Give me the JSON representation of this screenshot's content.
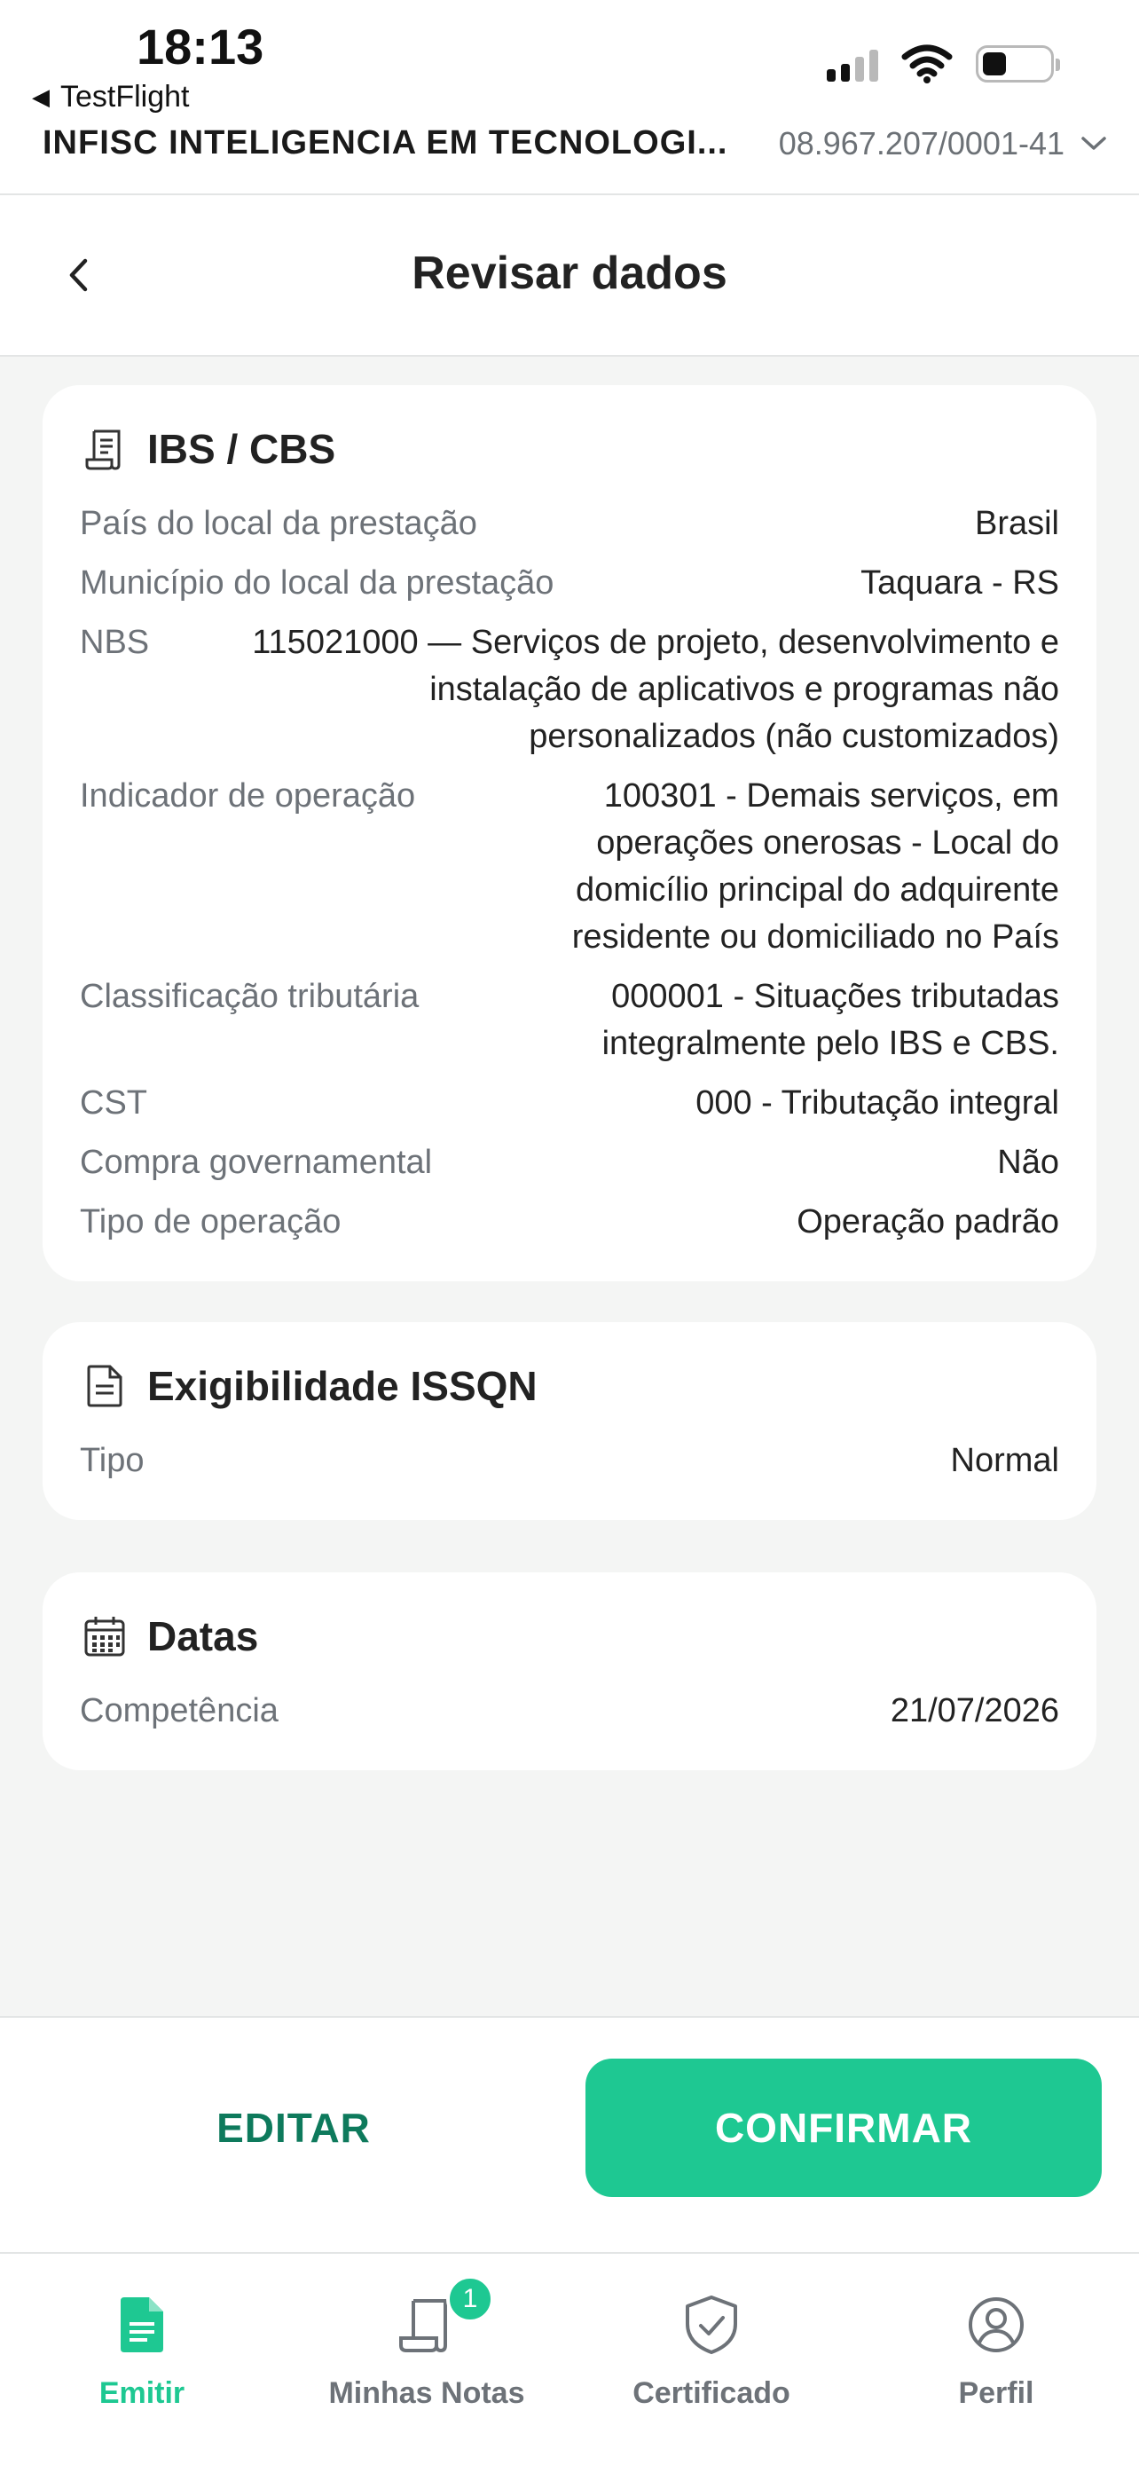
{
  "status_bar": {
    "time": "18:13",
    "back_app": "TestFlight"
  },
  "company": {
    "name": "INFISC INTELIGENCIA EM TECNOLOGI...",
    "cnpj": "08.967.207/0001-41"
  },
  "header": {
    "title": "Revisar dados"
  },
  "ibs_cbs": {
    "title": "IBS / CBS",
    "icon": "receipt-icon",
    "rows": [
      {
        "label": "País do local da prestação",
        "value": "Brasil"
      },
      {
        "label": "Município do local da prestação",
        "value": "Taquara - RS"
      },
      {
        "label": "NBS",
        "value": "115021000 — Serviços de projeto, desenvolvimento e instalação de aplicativos e programas não personalizados (não customizados)"
      },
      {
        "label": "Indicador de operação",
        "value": "100301 - Demais serviços, em operações onerosas - Local do domicílio principal do adquirente residente ou domiciliado no País"
      },
      {
        "label": "Classificação tributária",
        "value": "000001 - Situações tributadas integralmente pelo IBS e CBS."
      },
      {
        "label": "CST",
        "value": "000 - Tributação integral"
      },
      {
        "label": "Compra governamental",
        "value": "Não"
      },
      {
        "label": "Tipo de operação",
        "value": "Operação padrão"
      }
    ]
  },
  "issqn": {
    "title": "Exigibilidade ISSQN",
    "icon": "document-icon",
    "rows": [
      {
        "label": "Tipo",
        "value": "Normal"
      }
    ]
  },
  "datas": {
    "title": "Datas",
    "icon": "calendar-icon",
    "rows": [
      {
        "label": "Competência",
        "value": "21/07/2026"
      }
    ]
  },
  "actions": {
    "edit": "EDITAR",
    "confirm": "CONFIRMAR"
  },
  "tabs": [
    {
      "label": "Emitir",
      "icon": "document-filled-icon",
      "active": true
    },
    {
      "label": "Minhas Notas",
      "icon": "receipt-icon",
      "badge": "1"
    },
    {
      "label": "Certificado",
      "icon": "shield-check-icon"
    },
    {
      "label": "Perfil",
      "icon": "user-circle-icon"
    }
  ],
  "colors": {
    "accent": "#1ec892",
    "accent_dark": "#0e7a5c",
    "label_gray": "#6d7278"
  }
}
